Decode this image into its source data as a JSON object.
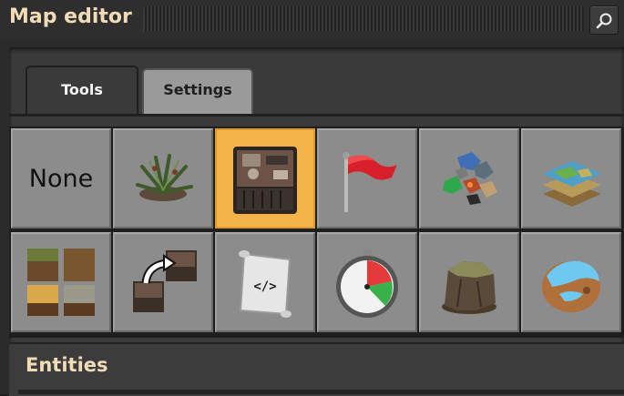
{
  "window": {
    "title": "Map editor"
  },
  "tabs": [
    {
      "label": "Tools",
      "selected": true
    },
    {
      "label": "Settings",
      "selected": false
    }
  ],
  "tools": [
    {
      "name": "none",
      "label": "None",
      "icon": "none-label"
    },
    {
      "name": "decoratives",
      "icon": "plant-icon"
    },
    {
      "name": "entities",
      "icon": "assembling-machine-icon",
      "selected": true
    },
    {
      "name": "forces",
      "icon": "red-flag-icon"
    },
    {
      "name": "resources",
      "icon": "ore-pile-icon"
    },
    {
      "name": "surfaces",
      "icon": "map-layers-icon"
    },
    {
      "name": "tiles",
      "icon": "tile-squares-icon"
    },
    {
      "name": "clone",
      "icon": "clone-arrow-icon"
    },
    {
      "name": "scripts",
      "icon": "script-scroll-icon"
    },
    {
      "name": "time",
      "icon": "stopwatch-icon"
    },
    {
      "name": "cliffs",
      "icon": "rock-icon"
    },
    {
      "name": "planets",
      "icon": "planet-icon"
    }
  ],
  "section": {
    "title": "Entities"
  },
  "colors": {
    "title_text": "#f2dcb8",
    "selected_slot": "#f3b54a",
    "slot": "#8c8c8c"
  }
}
